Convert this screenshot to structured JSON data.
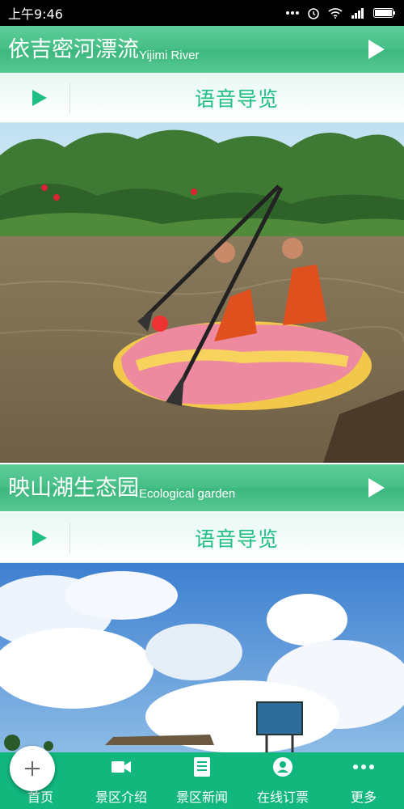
{
  "status": {
    "time": "上午9:46"
  },
  "sections": [
    {
      "title_zh": "依吉密河漂流",
      "title_en": "Yijimi River",
      "audio_label": "语音导览",
      "photo": "river-rafting-photo"
    },
    {
      "title_zh": "映山湖生态园",
      "title_en": "Ecological garden",
      "audio_label": "语音导览",
      "photo": "sky-clouds-photo"
    }
  ],
  "nav": [
    {
      "label": "首页",
      "icon": "home-icon"
    },
    {
      "label": "景区介绍",
      "icon": "video-icon"
    },
    {
      "label": "景区新闻",
      "icon": "news-icon"
    },
    {
      "label": "在线订票",
      "icon": "user-icon"
    },
    {
      "label": "更多",
      "icon": "more-icon"
    }
  ],
  "colors": {
    "accent": "#1fbf83",
    "nav_bg": "#12b77e",
    "title_bg": "#46bf86"
  }
}
